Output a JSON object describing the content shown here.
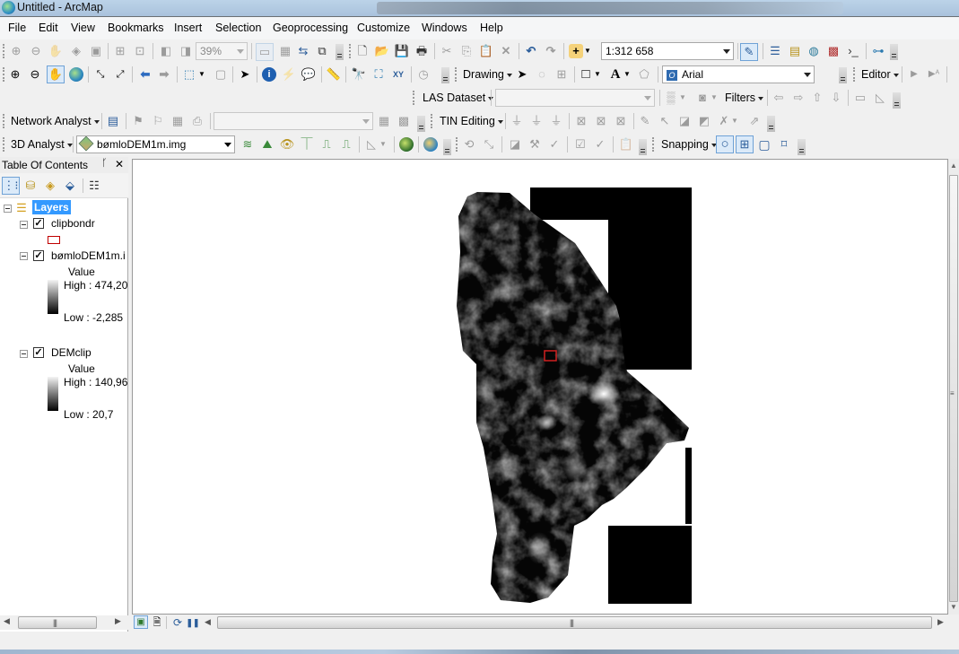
{
  "window": {
    "title": "Untitled - ArcMap",
    "app_icon": "arcmap-globe-icon"
  },
  "menubar": {
    "items": [
      "File",
      "Edit",
      "View",
      "Bookmarks",
      "Insert",
      "Selection",
      "Geoprocessing",
      "Customize",
      "Windows",
      "Help"
    ]
  },
  "toolbars": {
    "layout_zoom_value": "39%",
    "map_scale": "1:312 658",
    "drawing_label": "Drawing",
    "font_name": "Arial",
    "editor_label": "Editor",
    "las_dataset_label": "LAS Dataset",
    "las_dataset_value": "",
    "filters_label": "Filters",
    "network_analyst_label": "Network Analyst",
    "network_analyst_value": "",
    "tin_editing_label": "TIN Editing",
    "analyst_3d_label": "3D Analyst",
    "analyst_3d_layer": "bømloDEM1m.img",
    "snapping_label": "Snapping"
  },
  "toc": {
    "title": "Table Of Contents",
    "pin_icon": "pin-icon",
    "close_icon": "close-icon",
    "root_label": "Layers",
    "layers": [
      {
        "name": "clipbondr",
        "checked": true,
        "symbol": "red-outline-polygon",
        "symbol_color": "#c00000"
      },
      {
        "name": "bømloDEM1m.i",
        "checked": true,
        "field": "Value",
        "high": "High : 474,20",
        "low": "Low : -2,285"
      },
      {
        "name": "DEMclip",
        "checked": true,
        "field": "Value",
        "high": "High : 140,96",
        "low": "Low : 20,7"
      }
    ]
  },
  "map": {
    "background": "#ffffff",
    "raster_description": "Grayscale DEM raster (black background tiles) with red clip rectangle",
    "clip_box_color": "#d02020"
  },
  "bottom_bar": {
    "data_view_icon": "data-view-icon",
    "layout_view_icon": "layout-view-icon",
    "refresh_icon": "refresh-icon",
    "pause_icon": "pause-icon"
  }
}
